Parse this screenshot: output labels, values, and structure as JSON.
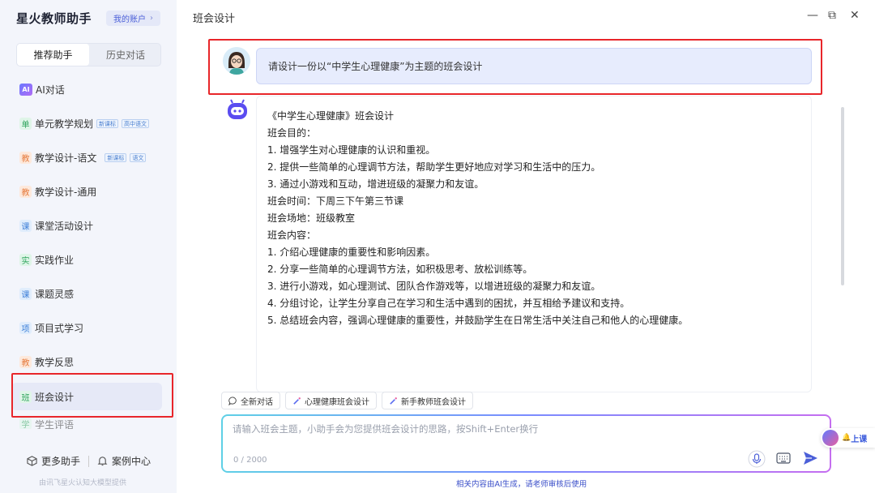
{
  "app": {
    "title": "星火教师助手",
    "account_label": "我的账户",
    "account_chevron": "›"
  },
  "sidebar": {
    "tabs": [
      {
        "label": "推荐助手",
        "active": true
      },
      {
        "label": "历史对话",
        "active": false
      }
    ],
    "items": [
      {
        "icon": "AI",
        "label": "AI对话"
      },
      {
        "icon": "单",
        "label": "单元教学规划",
        "badges": [
          "新课标",
          "高中语文"
        ]
      },
      {
        "icon": "教",
        "label": "教学设计-语文",
        "badges": [
          "新课标",
          "语文"
        ]
      },
      {
        "icon": "教",
        "label": "教学设计-通用"
      },
      {
        "icon": "课",
        "label": "课堂活动设计"
      },
      {
        "icon": "实",
        "label": "实践作业"
      },
      {
        "icon": "课",
        "label": "课题灵感"
      },
      {
        "icon": "项",
        "label": "项目式学习"
      },
      {
        "icon": "教",
        "label": "教学反思"
      },
      {
        "icon": "班",
        "label": "班会设计",
        "active": true
      },
      {
        "icon": "学",
        "label": "学生评语"
      }
    ],
    "bottom_links": {
      "more": "更多助手",
      "cases": "案例中心"
    },
    "footer_note": "由讯飞星火认知大模型提供"
  },
  "main": {
    "title": "班会设计",
    "window_controls": {
      "minimize": "—",
      "restore": "⧉",
      "close": "✕"
    },
    "user_message": "请设计一份以“中学生心理健康”为主题的班会设计",
    "answer_lines": [
      "《中学生心理健康》班会设计",
      "",
      "班会目的：",
      "1. 增强学生对心理健康的认识和重视。",
      "2. 提供一些简单的心理调节方法，帮助学生更好地应对学习和生活中的压力。",
      "3. 通过小游戏和互动，增进班级的凝聚力和友谊。",
      "",
      "班会时间：下周三下午第三节课",
      "",
      "班会场地：班级教室",
      "",
      "班会内容：",
      "1. 介绍心理健康的重要性和影响因素。",
      "2. 分享一些简单的心理调节方法，如积极思考、放松训练等。",
      "3. 进行小游戏，如心理测试、团队合作游戏等，以增进班级的凝聚力和友谊。",
      "4. 分组讨论，让学生分享自己在学习和生活中遇到的困扰，并互相给予建议和支持。",
      "5. 总结班会内容，强调心理健康的重要性，并鼓励学生在日常生活中关注自己和他人的心理健康。"
    ],
    "suggestion_chips": [
      {
        "icon": "chat-bubble-icon",
        "label": "全新对话"
      },
      {
        "icon": "magic-wand-icon",
        "label": "心理健康班会设计"
      },
      {
        "icon": "magic-wand-icon",
        "label": "新手教师班会设计"
      }
    ],
    "input": {
      "placeholder": "请输入班会主题，小助手会为您提供班会设计的思路，按Shift+Enter换行",
      "value": "",
      "counter": "0 / 2000"
    },
    "disclaimer": "相关内容由AI生成，请老师审核后使用",
    "float_button_label": "上课"
  },
  "colors": {
    "accent": "#4b5fd8",
    "highlight_box": "#e8262a",
    "user_bubble": "#e7ecfd",
    "sidebar_bg": "#f3f5fb"
  }
}
